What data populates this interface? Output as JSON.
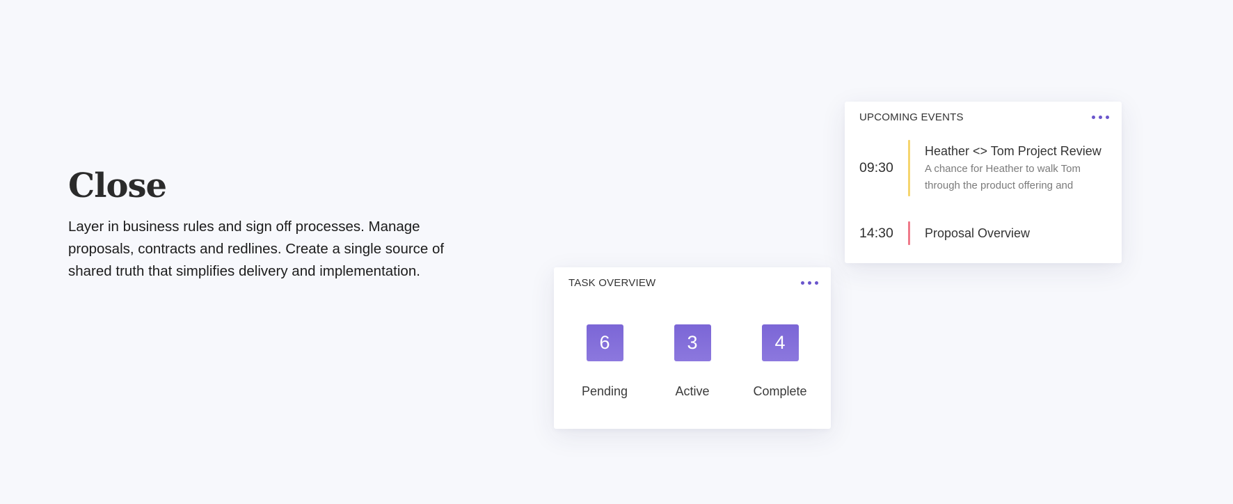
{
  "hero": {
    "title": "Close",
    "body": "Layer in business rules and sign off processes. Manage proposals, contracts and redlines. Create a single source of shared truth that simplifies delivery and implementation."
  },
  "events": {
    "title": "UPCOMING EVENTS",
    "more_icon": "more-horizontal-icon",
    "items": [
      {
        "time": "09:30",
        "title": "Heather <> Tom Project Review",
        "description": "A chance for Heather to walk Tom through the product offering and",
        "accent_color": "#f5d56e"
      },
      {
        "time": "14:30",
        "title": "Proposal Overview",
        "accent_color": "#ef7a8a"
      }
    ]
  },
  "tasks": {
    "title": "TASK OVERVIEW",
    "more_icon": "more-horizontal-icon",
    "items": [
      {
        "count": "6",
        "label": "Pending"
      },
      {
        "count": "3",
        "label": "Active"
      },
      {
        "count": "4",
        "label": "Complete"
      }
    ]
  },
  "colors": {
    "accent": "#6a55cc",
    "badge": "#7b66d6",
    "background": "#f7f8fc"
  }
}
